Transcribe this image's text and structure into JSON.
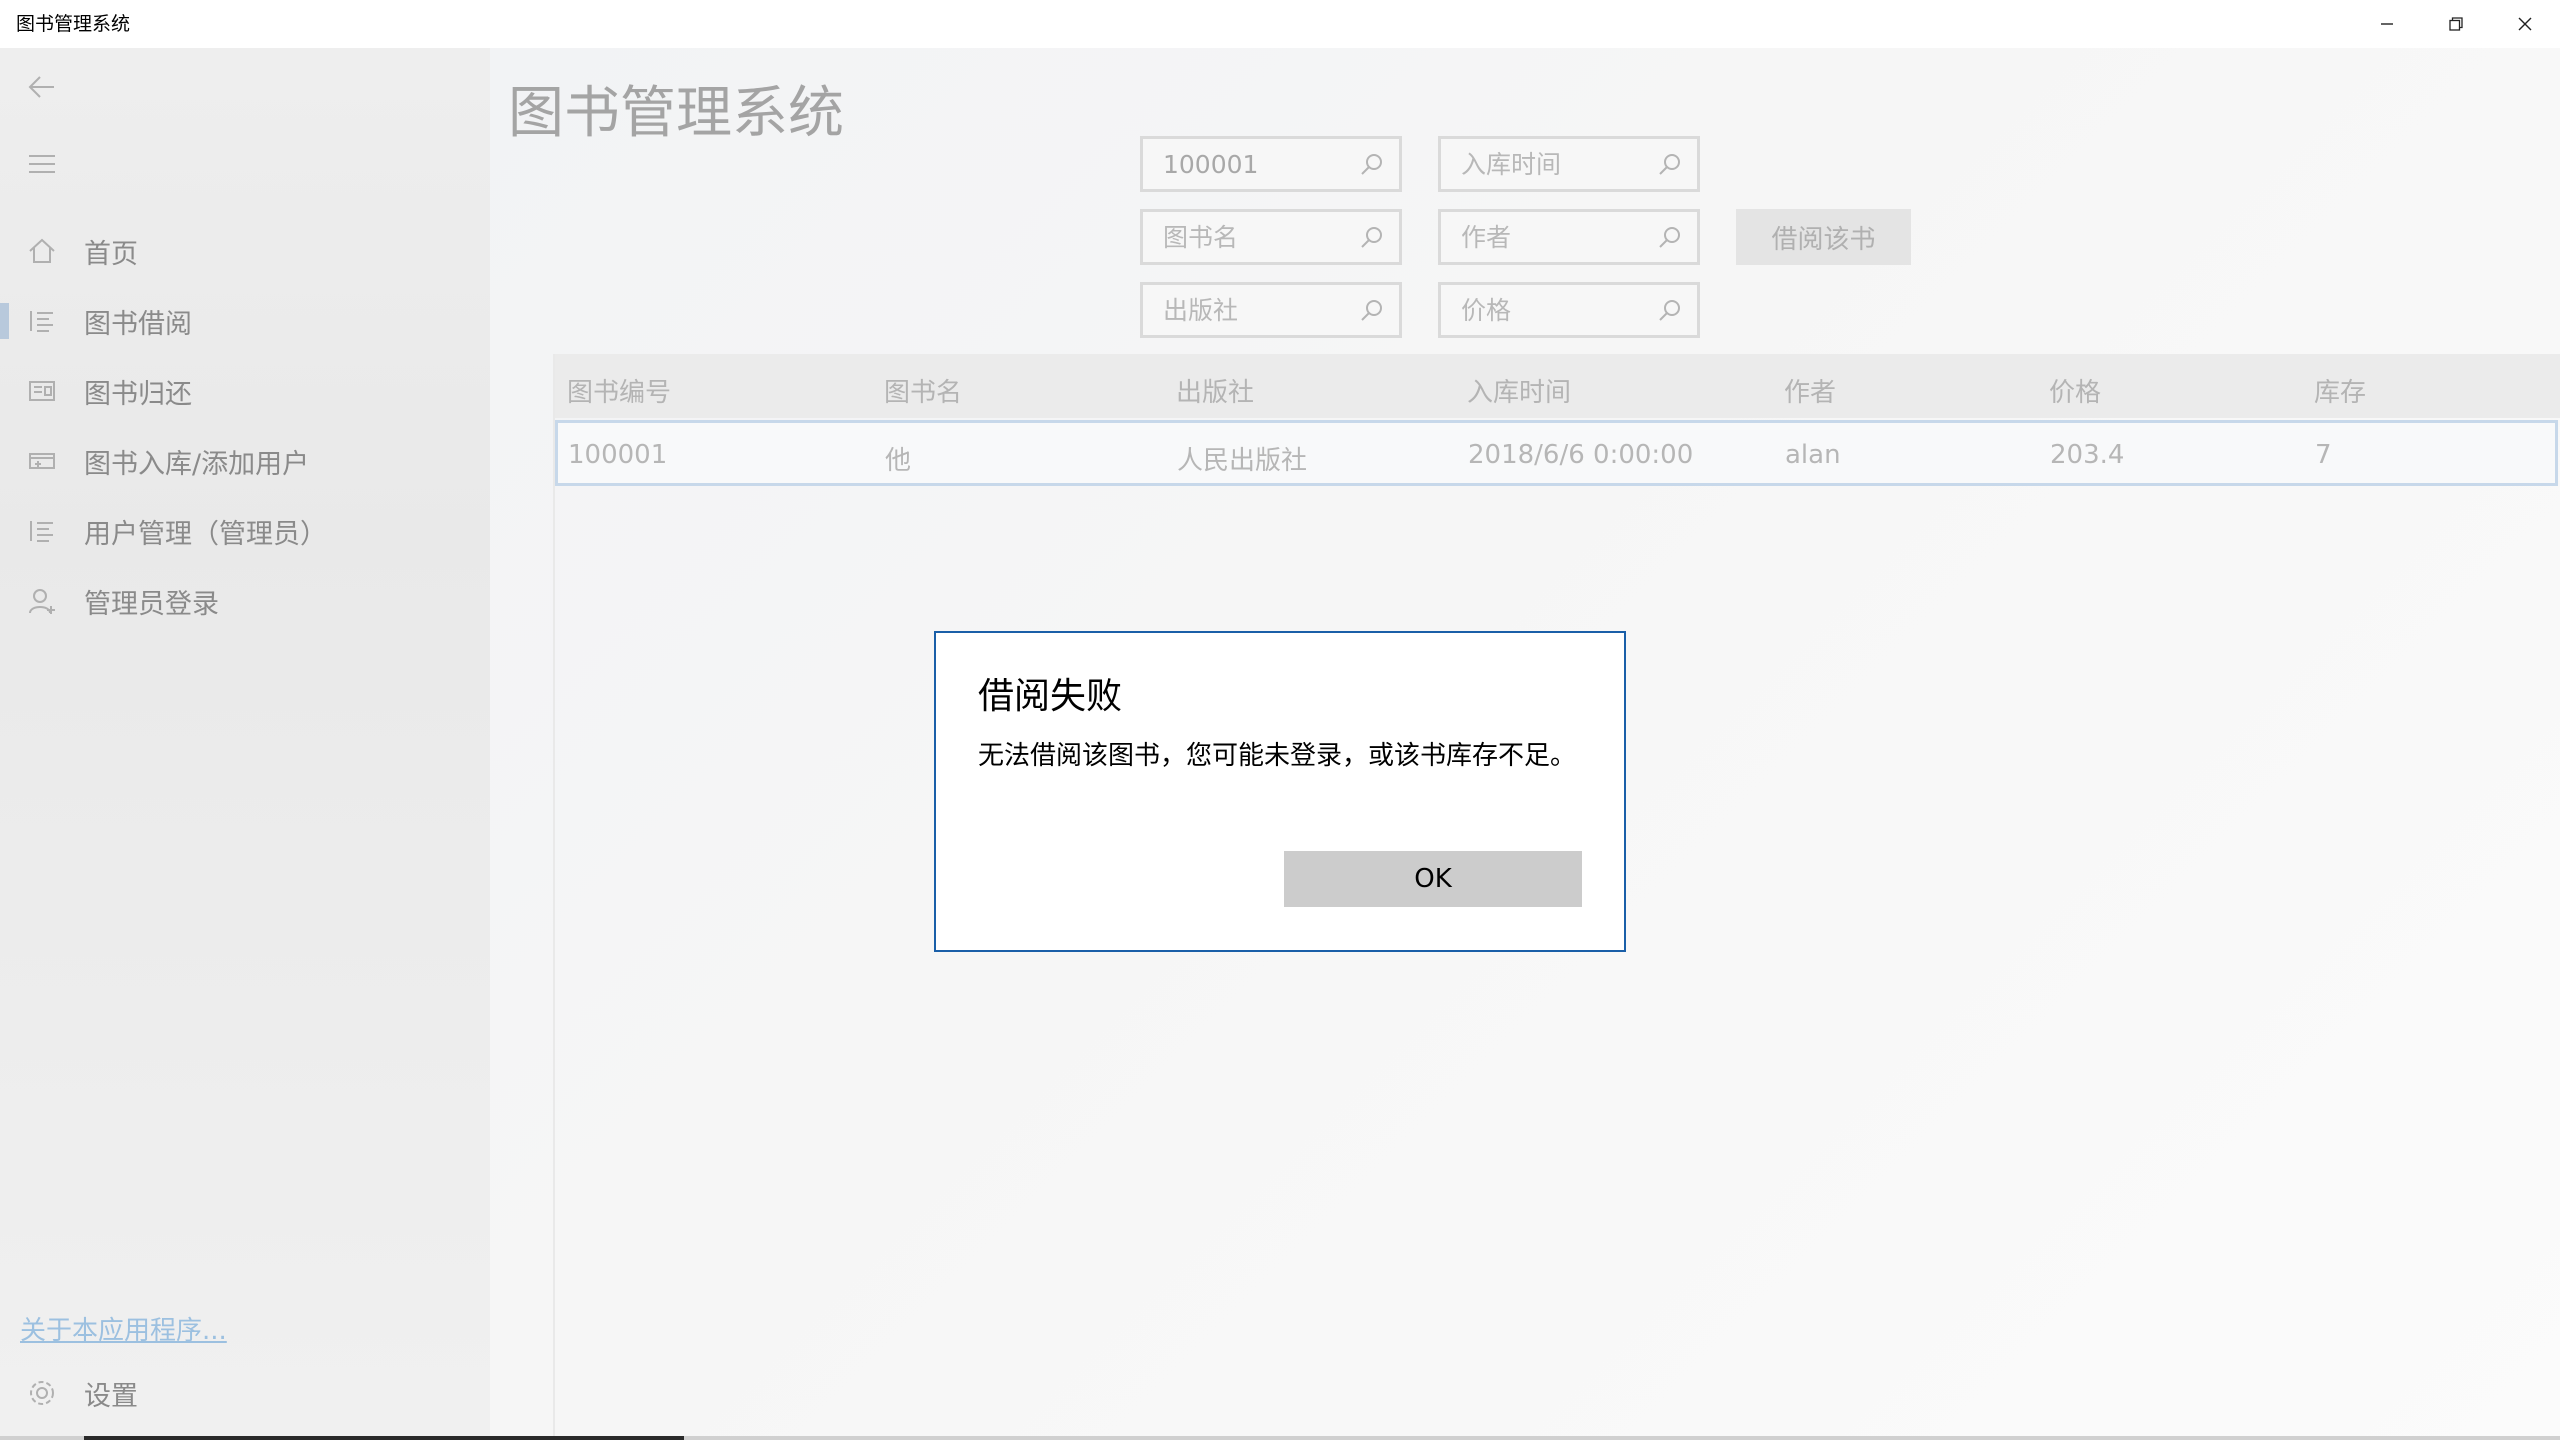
{
  "window": {
    "title": "图书管理系统"
  },
  "page": {
    "title": "图书管理系统"
  },
  "sidebar": {
    "items": [
      {
        "label": "首页",
        "icon": "home-icon"
      },
      {
        "label": "图书借阅",
        "icon": "list-icon",
        "selected": true
      },
      {
        "label": "图书归还",
        "icon": "book-icon"
      },
      {
        "label": "图书入库/添加用户",
        "icon": "add-card-icon"
      },
      {
        "label": "用户管理（管理员）",
        "icon": "list-icon"
      },
      {
        "label": "管理员登录",
        "icon": "person-icon"
      }
    ],
    "about_link": "关于本应用程序...",
    "settings_label": "设置"
  },
  "filters": {
    "id_value": "100001",
    "date_placeholder": "入库时间",
    "name_placeholder": "图书名",
    "author_placeholder": "作者",
    "publisher_placeholder": "出版社",
    "price_placeholder": "价格",
    "borrow_button": "借阅该书"
  },
  "table": {
    "columns": [
      "图书编号",
      "图书名",
      "出版社",
      "入库时间",
      "作者",
      "价格",
      "库存"
    ],
    "rows": [
      [
        "100001",
        "他",
        "人民出版社",
        "2018/6/6 0:00:00",
        "alan",
        "203.4",
        "7"
      ]
    ]
  },
  "dialog": {
    "title": "借阅失败",
    "message": "无法借阅该图书，您可能未登录，或该书库存不足。",
    "ok_label": "OK"
  },
  "colors": {
    "dialog_border": "#1a5fa8",
    "selected_row_border": "#c7d8ea",
    "link": "#9cc0e0"
  }
}
